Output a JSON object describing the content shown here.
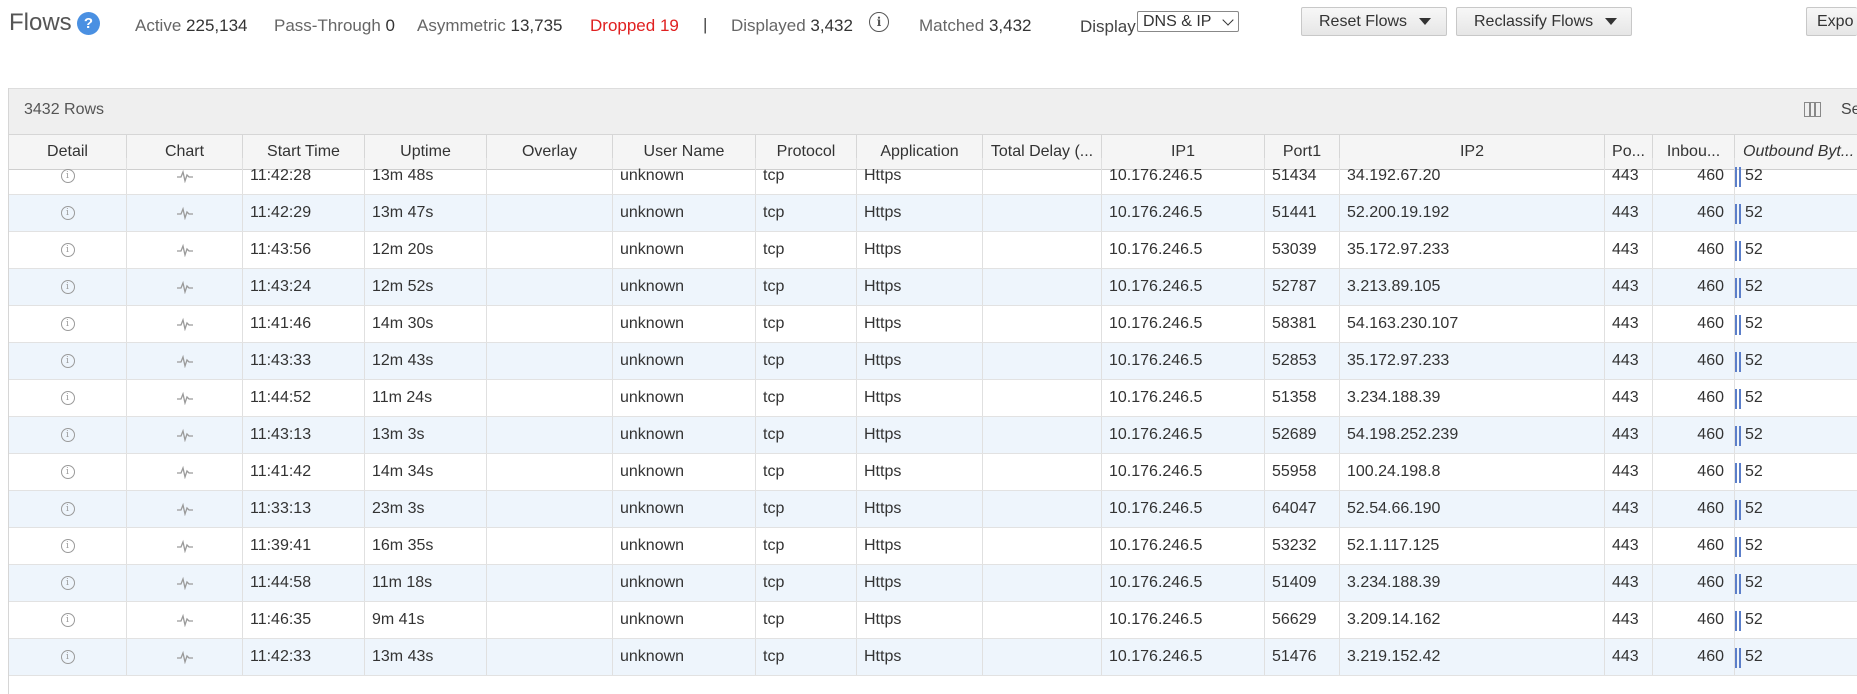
{
  "header": {
    "title": "Flows",
    "help_glyph": "?",
    "stats": {
      "active_label": "Active",
      "active_value": "225,134",
      "pass_label": "Pass-Through",
      "pass_value": "0",
      "asym_label": "Asymmetric",
      "asym_value": "13,735",
      "dropped_label": "Dropped",
      "dropped_value": "19",
      "separator": "|",
      "displayed_label": "Displayed",
      "displayed_value": "3,432",
      "matched_label": "Matched",
      "matched_value": "3,432"
    },
    "info_glyph": "i",
    "display_label": "Display",
    "display_value": "DNS & IP",
    "reset_button": "Reset Flows",
    "reclassify_button": "Reclassify Flows",
    "export_button": "Expo"
  },
  "grid": {
    "rows_label": "3432 Rows",
    "rows_right_text": "Se",
    "columns": [
      "Detail",
      "Chart",
      "Start Time",
      "Uptime",
      "Overlay",
      "User Name",
      "Protocol",
      "Application",
      "Total Delay (...",
      "IP1",
      "Port1",
      "IP2",
      "Po...",
      "Inbou...",
      "Outbound Byt..."
    ],
    "detail_glyph": "i",
    "rows": [
      {
        "start": "11:42:28",
        "uptime": "13m 48s",
        "overlay": "",
        "user": "unknown",
        "protocol": "tcp",
        "app": "Https",
        "delay": "",
        "ip1": "10.176.246.5",
        "port1": "51434",
        "ip2": "34.192.67.20",
        "port2": "443",
        "inbound": "460",
        "outbound": "52"
      },
      {
        "start": "11:42:29",
        "uptime": "13m 47s",
        "overlay": "",
        "user": "unknown",
        "protocol": "tcp",
        "app": "Https",
        "delay": "",
        "ip1": "10.176.246.5",
        "port1": "51441",
        "ip2": "52.200.19.192",
        "port2": "443",
        "inbound": "460",
        "outbound": "52"
      },
      {
        "start": "11:43:56",
        "uptime": "12m 20s",
        "overlay": "",
        "user": "unknown",
        "protocol": "tcp",
        "app": "Https",
        "delay": "",
        "ip1": "10.176.246.5",
        "port1": "53039",
        "ip2": "35.172.97.233",
        "port2": "443",
        "inbound": "460",
        "outbound": "52"
      },
      {
        "start": "11:43:24",
        "uptime": "12m 52s",
        "overlay": "",
        "user": "unknown",
        "protocol": "tcp",
        "app": "Https",
        "delay": "",
        "ip1": "10.176.246.5",
        "port1": "52787",
        "ip2": "3.213.89.105",
        "port2": "443",
        "inbound": "460",
        "outbound": "52"
      },
      {
        "start": "11:41:46",
        "uptime": "14m 30s",
        "overlay": "",
        "user": "unknown",
        "protocol": "tcp",
        "app": "Https",
        "delay": "",
        "ip1": "10.176.246.5",
        "port1": "58381",
        "ip2": "54.163.230.107",
        "port2": "443",
        "inbound": "460",
        "outbound": "52"
      },
      {
        "start": "11:43:33",
        "uptime": "12m 43s",
        "overlay": "",
        "user": "unknown",
        "protocol": "tcp",
        "app": "Https",
        "delay": "",
        "ip1": "10.176.246.5",
        "port1": "52853",
        "ip2": "35.172.97.233",
        "port2": "443",
        "inbound": "460",
        "outbound": "52"
      },
      {
        "start": "11:44:52",
        "uptime": "11m 24s",
        "overlay": "",
        "user": "unknown",
        "protocol": "tcp",
        "app": "Https",
        "delay": "",
        "ip1": "10.176.246.5",
        "port1": "51358",
        "ip2": "3.234.188.39",
        "port2": "443",
        "inbound": "460",
        "outbound": "52"
      },
      {
        "start": "11:43:13",
        "uptime": "13m 3s",
        "overlay": "",
        "user": "unknown",
        "protocol": "tcp",
        "app": "Https",
        "delay": "",
        "ip1": "10.176.246.5",
        "port1": "52689",
        "ip2": "54.198.252.239",
        "port2": "443",
        "inbound": "460",
        "outbound": "52"
      },
      {
        "start": "11:41:42",
        "uptime": "14m 34s",
        "overlay": "",
        "user": "unknown",
        "protocol": "tcp",
        "app": "Https",
        "delay": "",
        "ip1": "10.176.246.5",
        "port1": "55958",
        "ip2": "100.24.198.8",
        "port2": "443",
        "inbound": "460",
        "outbound": "52"
      },
      {
        "start": "11:33:13",
        "uptime": "23m 3s",
        "overlay": "",
        "user": "unknown",
        "protocol": "tcp",
        "app": "Https",
        "delay": "",
        "ip1": "10.176.246.5",
        "port1": "64047",
        "ip2": "52.54.66.190",
        "port2": "443",
        "inbound": "460",
        "outbound": "52"
      },
      {
        "start": "11:39:41",
        "uptime": "16m 35s",
        "overlay": "",
        "user": "unknown",
        "protocol": "tcp",
        "app": "Https",
        "delay": "",
        "ip1": "10.176.246.5",
        "port1": "53232",
        "ip2": "52.1.117.125",
        "port2": "443",
        "inbound": "460",
        "outbound": "52"
      },
      {
        "start": "11:44:58",
        "uptime": "11m 18s",
        "overlay": "",
        "user": "unknown",
        "protocol": "tcp",
        "app": "Https",
        "delay": "",
        "ip1": "10.176.246.5",
        "port1": "51409",
        "ip2": "3.234.188.39",
        "port2": "443",
        "inbound": "460",
        "outbound": "52"
      },
      {
        "start": "11:46:35",
        "uptime": "9m 41s",
        "overlay": "",
        "user": "unknown",
        "protocol": "tcp",
        "app": "Https",
        "delay": "",
        "ip1": "10.176.246.5",
        "port1": "56629",
        "ip2": "3.209.14.162",
        "port2": "443",
        "inbound": "460",
        "outbound": "52"
      },
      {
        "start": "11:42:33",
        "uptime": "13m 43s",
        "overlay": "",
        "user": "unknown",
        "protocol": "tcp",
        "app": "Https",
        "delay": "",
        "ip1": "10.176.246.5",
        "port1": "51476",
        "ip2": "3.219.152.42",
        "port2": "443",
        "inbound": "460",
        "outbound": "52"
      }
    ]
  },
  "colors": {
    "accent_blue": "#4a90e2",
    "dropped_red": "#e02020",
    "row_alt": "#eef5fc",
    "bar_blue": "#5b7ec9"
  },
  "icons": {
    "help": "help-circle-icon",
    "info": "info-circle-icon",
    "columns": "columns-icon",
    "detail": "info-small-icon",
    "chart": "pulse-chart-icon"
  }
}
